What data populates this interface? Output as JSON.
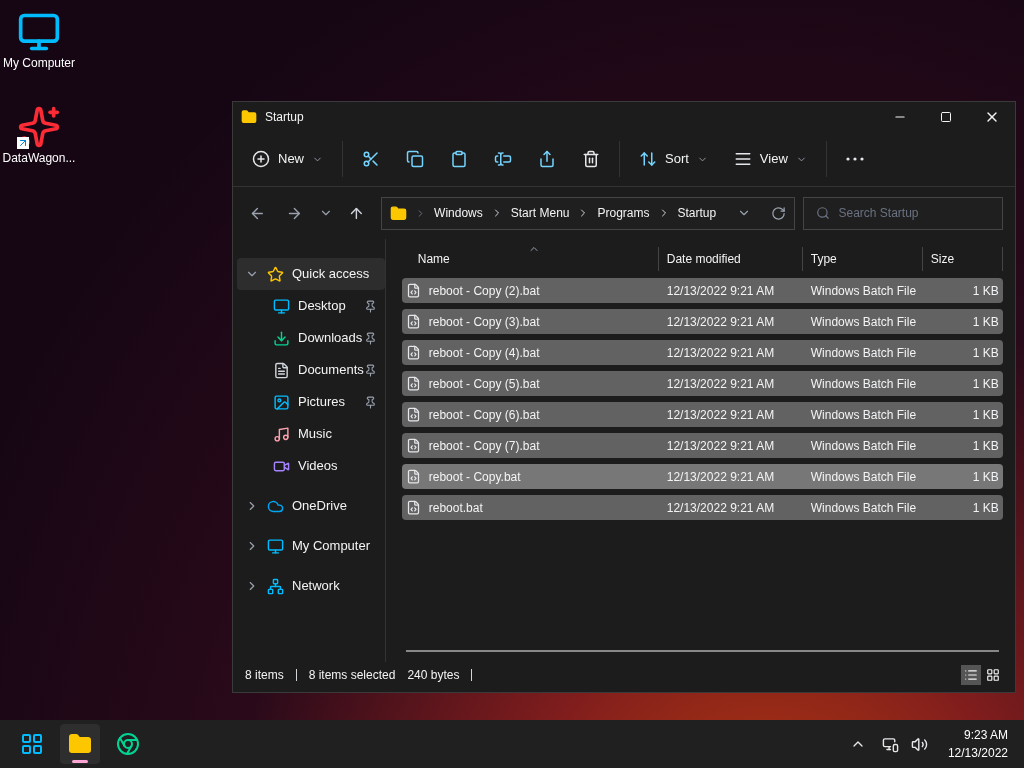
{
  "desktop_icons": [
    {
      "label": "My Computer",
      "kind": "computer",
      "shortcut": false
    },
    {
      "label": "DataWagon...",
      "kind": "star",
      "shortcut": true
    }
  ],
  "window": {
    "title": "Startup"
  },
  "toolbar": [
    {
      "kind": "new",
      "label": "New"
    },
    {
      "kind": "cut"
    },
    {
      "kind": "copy"
    },
    {
      "kind": "paste"
    },
    {
      "kind": "rename"
    },
    {
      "kind": "share"
    },
    {
      "kind": "delete"
    },
    {
      "kind": "sort",
      "label": "Sort"
    },
    {
      "kind": "view",
      "label": "View"
    },
    {
      "kind": "more"
    }
  ],
  "breadcrumb": [
    "Windows",
    "Start Menu",
    "Programs",
    "Startup"
  ],
  "search": {
    "placeholder": "Search Startup"
  },
  "sidebar": {
    "items": [
      {
        "label": "Quick access",
        "kind": "star",
        "expanded": true,
        "selected": true,
        "children": [
          {
            "label": "Desktop",
            "kind": "desktop",
            "pinned": true,
            "selected": false
          },
          {
            "label": "Downloads",
            "kind": "download",
            "pinned": true,
            "selected": false
          },
          {
            "label": "Documents",
            "kind": "document",
            "pinned": true,
            "selected": false
          },
          {
            "label": "Pictures",
            "kind": "picture",
            "pinned": true,
            "selected": false
          },
          {
            "label": "Music",
            "kind": "music",
            "pinned": false,
            "selected": false
          },
          {
            "label": "Videos",
            "kind": "video",
            "pinned": false,
            "selected": false
          }
        ]
      },
      {
        "label": "OneDrive",
        "kind": "cloud",
        "expanded": false,
        "selected": false
      },
      {
        "label": "My Computer",
        "kind": "computer",
        "expanded": false,
        "selected": false
      },
      {
        "label": "Network",
        "kind": "network",
        "expanded": false,
        "selected": false
      }
    ]
  },
  "table": {
    "columns": [
      "Name",
      "Date modified",
      "Type",
      "Size"
    ],
    "rows": [
      {
        "name": "reboot - Copy (2).bat",
        "date": "12/13/2022 9:21 AM",
        "type": "Windows Batch File",
        "size": "1 KB",
        "selected": true,
        "hovered": false
      },
      {
        "name": "reboot - Copy (3).bat",
        "date": "12/13/2022 9:21 AM",
        "type": "Windows Batch File",
        "size": "1 KB",
        "selected": true,
        "hovered": false
      },
      {
        "name": "reboot - Copy (4).bat",
        "date": "12/13/2022 9:21 AM",
        "type": "Windows Batch File",
        "size": "1 KB",
        "selected": true,
        "hovered": false
      },
      {
        "name": "reboot - Copy (5).bat",
        "date": "12/13/2022 9:21 AM",
        "type": "Windows Batch File",
        "size": "1 KB",
        "selected": true,
        "hovered": false
      },
      {
        "name": "reboot - Copy (6).bat",
        "date": "12/13/2022 9:21 AM",
        "type": "Windows Batch File",
        "size": "1 KB",
        "selected": true,
        "hovered": false
      },
      {
        "name": "reboot - Copy (7).bat",
        "date": "12/13/2022 9:21 AM",
        "type": "Windows Batch File",
        "size": "1 KB",
        "selected": true,
        "hovered": false
      },
      {
        "name": "reboot - Copy.bat",
        "date": "12/13/2022 9:21 AM",
        "type": "Windows Batch File",
        "size": "1 KB",
        "selected": true,
        "hovered": true
      },
      {
        "name": "reboot.bat",
        "date": "12/13/2022 9:21 AM",
        "type": "Windows Batch File",
        "size": "1 KB",
        "selected": true,
        "hovered": false
      }
    ]
  },
  "status_bar": {
    "items": "8 items",
    "selection": "8 items selected",
    "size": "240 bytes",
    "views": [
      {
        "kind": "details",
        "selected": true
      },
      {
        "kind": "tiles",
        "selected": false
      }
    ]
  },
  "taskbar": {
    "apps": [
      {
        "kind": "start",
        "running": false
      },
      {
        "kind": "explorer",
        "running": true
      },
      {
        "kind": "browser",
        "running": false
      }
    ],
    "time": "9:23 AM",
    "date": "12/13/2022"
  }
}
